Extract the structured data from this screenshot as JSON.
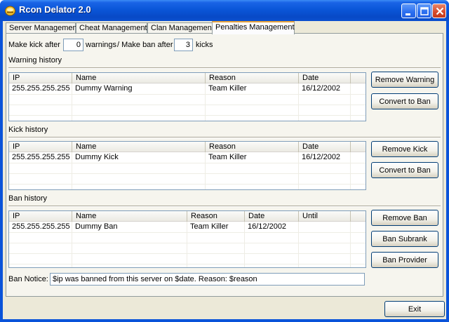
{
  "window": {
    "title": "Rcon Delator 2.0"
  },
  "tabs": [
    {
      "label": "Server Management"
    },
    {
      "label": "Cheat Management"
    },
    {
      "label": "Clan Management"
    },
    {
      "label": "Penalties Management",
      "active": true
    }
  ],
  "settings": {
    "kick_prefix": "Make kick after",
    "warnings_value": "0",
    "warnings_suffix": "warnings",
    "ban_prefix": "/ Make ban after",
    "kicks_value": "3",
    "kicks_suffix": "kicks"
  },
  "warning_history": {
    "title": "Warning history",
    "columns": [
      "IP",
      "Name",
      "Reason",
      "Date"
    ],
    "rows": [
      [
        "255.255.255.255",
        "Dummy Warning",
        "Team Killer",
        "16/12/2002"
      ]
    ],
    "buttons": {
      "remove": "Remove Warning",
      "convert": "Convert to Ban"
    }
  },
  "kick_history": {
    "title": "Kick history",
    "columns": [
      "IP",
      "Name",
      "Reason",
      "Date"
    ],
    "rows": [
      [
        "255.255.255.255",
        "Dummy Kick",
        "Team Killer",
        "16/12/2002"
      ]
    ],
    "buttons": {
      "remove": "Remove Kick",
      "convert": "Convert to Ban"
    }
  },
  "ban_history": {
    "title": "Ban history",
    "columns": [
      "IP",
      "Name",
      "Reason",
      "Date",
      "Until"
    ],
    "rows": [
      [
        "255.255.255.255",
        "Dummy Ban",
        "Team Killer",
        "16/12/2002",
        ""
      ]
    ],
    "buttons": {
      "remove": "Remove Ban",
      "subrank": "Ban Subrank",
      "provider": "Ban Provider"
    }
  },
  "ban_notice": {
    "label": "Ban Notice:",
    "value": "$ip was banned from this server on $date. Reason: $reason"
  },
  "footer": {
    "exit": "Exit"
  },
  "icons": {
    "app": "app-icon",
    "minimize": "minimize-icon",
    "maximize": "maximize-icon",
    "close": "close-icon"
  },
  "colors": {
    "titlebar": "#0a56d8",
    "active_tab_accent": "#e8a33d",
    "face": "#ece9d8"
  }
}
